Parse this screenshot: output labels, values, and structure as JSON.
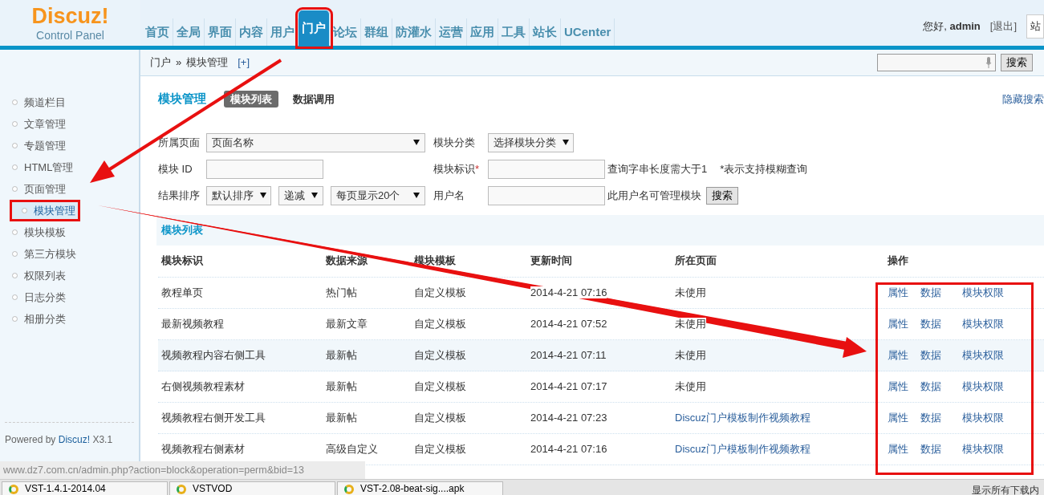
{
  "header": {
    "logo": {
      "title": "Discuz!",
      "subtitle": "Control Panel"
    },
    "nav": [
      {
        "label": "首页",
        "selected": false,
        "annotated": false
      },
      {
        "label": "全局",
        "selected": false,
        "annotated": false
      },
      {
        "label": "界面",
        "selected": false,
        "annotated": false
      },
      {
        "label": "内容",
        "selected": false,
        "annotated": false
      },
      {
        "label": "用户",
        "selected": false,
        "annotated": false
      },
      {
        "label": "门户",
        "selected": true,
        "annotated": true
      },
      {
        "label": "论坛",
        "selected": false,
        "annotated": false
      },
      {
        "label": "群组",
        "selected": false,
        "annotated": false
      },
      {
        "label": "防灌水",
        "selected": false,
        "annotated": false
      },
      {
        "label": "运营",
        "selected": false,
        "annotated": false
      },
      {
        "label": "应用",
        "selected": false,
        "annotated": false
      },
      {
        "label": "工具",
        "selected": false,
        "annotated": false
      },
      {
        "label": "站长",
        "selected": false,
        "annotated": false
      },
      {
        "label": "UCenter",
        "selected": false,
        "annotated": false
      }
    ],
    "user": {
      "greeting": "您好,",
      "name": "admin",
      "logout": "[退出]"
    },
    "site_select": "站"
  },
  "breadcrumb": {
    "items": [
      "门户",
      "模块管理"
    ],
    "separator": "»",
    "add": "[+]"
  },
  "top_search": {
    "button": "搜索"
  },
  "sidebar": {
    "items": [
      {
        "label": "频道栏目",
        "selected": false,
        "annotated": false
      },
      {
        "label": "文章管理",
        "selected": false,
        "annotated": false
      },
      {
        "label": "专题管理",
        "selected": false,
        "annotated": false
      },
      {
        "label": "HTML管理",
        "selected": false,
        "annotated": false
      },
      {
        "label": "页面管理",
        "selected": false,
        "annotated": false
      },
      {
        "label": "模块管理",
        "selected": true,
        "annotated": true
      },
      {
        "label": "模块模板",
        "selected": false,
        "annotated": false
      },
      {
        "label": "第三方模块",
        "selected": false,
        "annotated": false
      },
      {
        "label": "权限列表",
        "selected": false,
        "annotated": false
      },
      {
        "label": "日志分类",
        "selected": false,
        "annotated": false
      },
      {
        "label": "相册分类",
        "selected": false,
        "annotated": false
      }
    ],
    "footer": {
      "text": "Powered by",
      "link": "Discuz!",
      "version": "X3.1"
    }
  },
  "main": {
    "title": "模块管理",
    "tabs": [
      {
        "label": "模块列表",
        "selected": true
      },
      {
        "label": "数据调用",
        "selected": false
      }
    ],
    "hide_search": "隐藏搜索"
  },
  "filters": {
    "page_label": "所属页面",
    "page_select": "页面名称",
    "category_label": "模块分类",
    "category_select": "选择模块分类",
    "id_label": "模块 ID",
    "mark_label": "模块标识",
    "mark_required": "*",
    "hint_length": "查询字串长度需大于1",
    "hint_fuzzy": "*表示支持模糊查询",
    "sort_label": "结果排序",
    "sort_select": "默认排序",
    "order_select": "递减",
    "perpage_select": "每页显示20个",
    "user_label": "用户名",
    "user_hint": "此用户名可管理模块",
    "search_button": "搜索"
  },
  "table": {
    "title": "模块列表",
    "actions_annotated": true,
    "columns": [
      "模块标识",
      "数据来源",
      "模块模板",
      "更新时间",
      "所在页面",
      "操作"
    ],
    "rows": [
      {
        "cells": [
          "教程单页",
          "热门帖",
          "自定义模板",
          "2014-4-21 07:16"
        ],
        "page": {
          "text": "未使用",
          "kind": "text"
        },
        "highlighted": false,
        "actions": [
          "属性",
          "数据",
          "模块权限"
        ]
      },
      {
        "cells": [
          "最新视频教程",
          "最新文章",
          "自定义模板",
          "2014-4-21 07:52"
        ],
        "page": {
          "text": "未使用",
          "kind": "text"
        },
        "highlighted": false,
        "actions": [
          "属性",
          "数据",
          "模块权限"
        ]
      },
      {
        "cells": [
          "视频教程内容右侧工具",
          "最新帖",
          "自定义模板",
          "2014-4-21 07:11"
        ],
        "page": {
          "text": "未使用",
          "kind": "text"
        },
        "highlighted": true,
        "actions": [
          "属性",
          "数据",
          "模块权限"
        ]
      },
      {
        "cells": [
          "右侧视频教程素材",
          "最新帖",
          "自定义模板",
          "2014-4-21 07:17"
        ],
        "page": {
          "text": "未使用",
          "kind": "text"
        },
        "highlighted": false,
        "actions": [
          "属性",
          "数据",
          "模块权限"
        ]
      },
      {
        "cells": [
          "视频教程右侧开发工具",
          "最新帖",
          "自定义模板",
          "2014-4-21 07:23"
        ],
        "page": {
          "text": "Discuz门户模板制作视频教程",
          "kind": "link"
        },
        "highlighted": false,
        "actions": [
          "属性",
          "数据",
          "模块权限"
        ]
      },
      {
        "cells": [
          "视频教程右侧素材",
          "高级自定义",
          "自定义模板",
          "2014-4-21 07:16"
        ],
        "page": {
          "text": "Discuz门户模板制作视频教程",
          "kind": "link"
        },
        "highlighted": false,
        "actions": [
          "属性",
          "数据",
          "模块权限"
        ]
      }
    ]
  },
  "status_url": "www.dz7.com.cn/admin.php?action=block&operation=perm&bid=13",
  "downloads": {
    "items": [
      "VST-1.4.1-2014.04",
      "VSTVOD",
      "VST-2.08-beat-sig....apk"
    ],
    "show_all": "显示所有下载内"
  }
}
